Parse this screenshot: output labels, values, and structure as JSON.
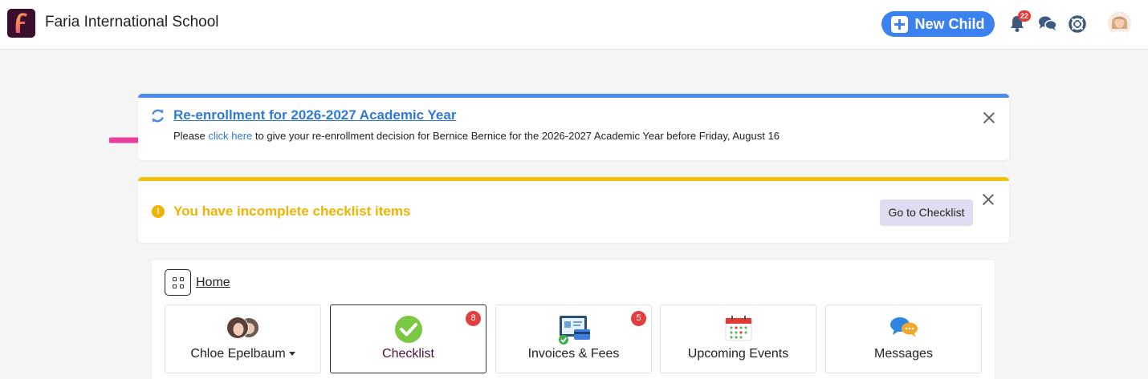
{
  "header": {
    "school_name": "Faria International School",
    "new_child_label": "New Child",
    "notifications_count": "22"
  },
  "reenrollment": {
    "title": "Re-enrollment for 2026-2027 Academic Year",
    "text_before": "Please ",
    "link_text": "click here",
    "text_after": " to give your re-enrollment decision for Bernice Bernice for the 2026-2027 Academic Year before Friday, August 16"
  },
  "checklist_alert": {
    "warning_symbol": "!",
    "message": "You have incomplete checklist items",
    "button_label": "Go to Checklist"
  },
  "home": {
    "breadcrumb_label": "Home",
    "tiles": [
      {
        "label": "Chloe Epelbaum",
        "icon": "children-avatars-icon",
        "has_dropdown": true
      },
      {
        "label": "Checklist",
        "icon": "green-check-icon",
        "badge": "8",
        "active": true
      },
      {
        "label": "Invoices & Fees",
        "icon": "invoice-icon",
        "badge": "5"
      },
      {
        "label": "Upcoming Events",
        "icon": "calendar-icon"
      },
      {
        "label": "Messages",
        "icon": "chat-bubbles-icon"
      }
    ]
  },
  "colors": {
    "brand_dark": "#3a0f2e",
    "primary_blue": "#3b82f0",
    "link_blue": "#2f7ad8",
    "warning_yellow": "#f0b400",
    "badge_red": "#e04040",
    "annotation_pink": "#e83e9c"
  }
}
